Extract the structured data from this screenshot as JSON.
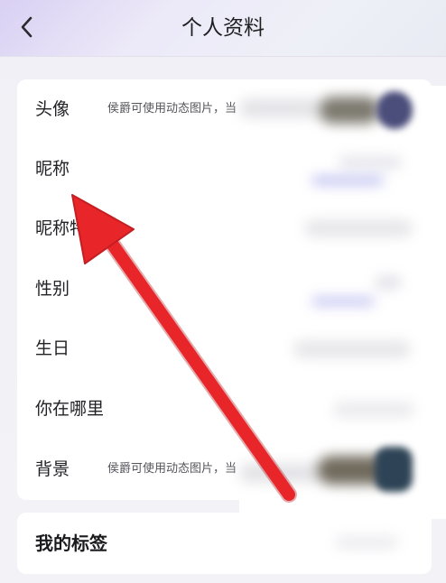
{
  "header": {
    "title": "个人资料",
    "back_icon": "chevron-left-icon"
  },
  "profile": {
    "rows": [
      {
        "key": "avatar",
        "label": "头像",
        "hint": "侯爵可使用动态图片，当"
      },
      {
        "key": "nickname",
        "label": "昵称",
        "hint": ""
      },
      {
        "key": "nickname-special",
        "label": "昵称特",
        "hint": ""
      },
      {
        "key": "gender",
        "label": "性别",
        "hint": ""
      },
      {
        "key": "birthday",
        "label": "生日",
        "hint": ""
      },
      {
        "key": "location",
        "label": "你在哪里",
        "hint": ""
      },
      {
        "key": "background",
        "label": "背景",
        "hint": "侯爵可使用动态图片，当"
      }
    ]
  },
  "tags": {
    "title": "我的标签"
  },
  "annotation": {
    "arrow_color": "#e8262a"
  }
}
